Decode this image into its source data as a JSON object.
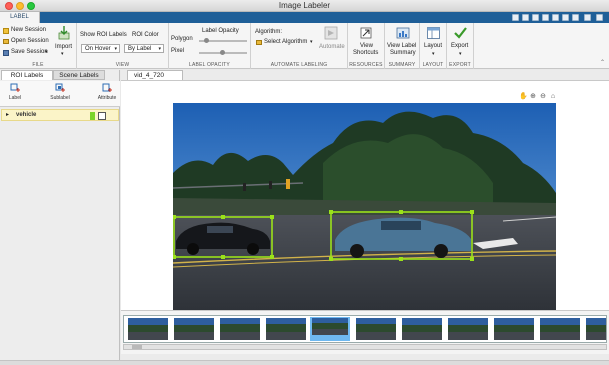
{
  "window": {
    "title": "Image Labeler"
  },
  "tabs": {
    "active": "LABEL"
  },
  "ribbon": {
    "file": {
      "section_label": "FILE",
      "new_session": "New Session",
      "open_session": "Open Session",
      "save_session": "Save Session",
      "import": "Import"
    },
    "view": {
      "section_label": "VIEW",
      "show_roi_labels": "Show ROI Labels",
      "show_roi_labels_value": "On Hover",
      "roi_color": "ROI Color",
      "roi_color_value": "By Label"
    },
    "label_opacity": {
      "section_label": "LABEL OPACITY",
      "title": "Label Opacity",
      "polygon": "Polygon",
      "pixel": "Pixel"
    },
    "automate": {
      "section_label": "AUTOMATE LABELING",
      "algorithm_label": "Algorithm:",
      "algorithm_value": "Select Algorithm",
      "automate_button": "Automate"
    },
    "resources": {
      "section_label": "RESOURCES",
      "view_shortcuts_line1": "View",
      "view_shortcuts_line2": "Shortcuts"
    },
    "summary": {
      "section_label": "SUMMARY",
      "view_label_line1": "View Label",
      "view_label_line2": "Summary"
    },
    "layout": {
      "section_label": "LAYOUT",
      "button": "Layout"
    },
    "export": {
      "section_label": "EXPORT",
      "button": "Export"
    }
  },
  "left_panel": {
    "tabs": [
      "ROI Labels",
      "Scene Labels"
    ],
    "tools": [
      "Label",
      "Sublabel",
      "Attribute"
    ],
    "labels": [
      {
        "name": "vehicle",
        "color": "#7bd42a"
      }
    ]
  },
  "document": {
    "tab": "vid_4_720"
  },
  "colors": {
    "accent": "#1f5f98",
    "roi": "#9be21a",
    "selected_frame": "#6fb8f0"
  }
}
